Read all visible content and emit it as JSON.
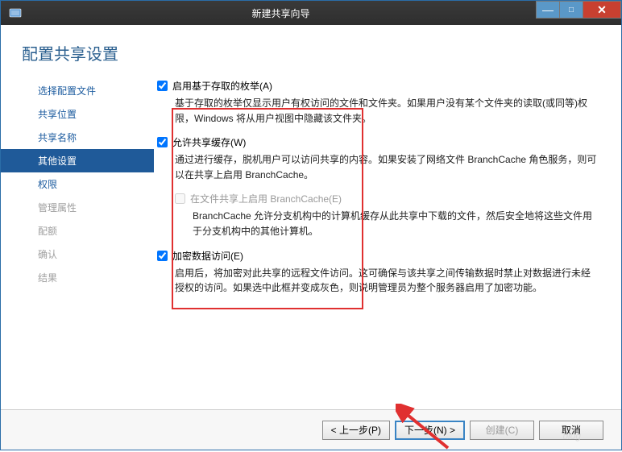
{
  "window": {
    "title": "新建共享向导"
  },
  "header": {
    "title": "配置共享设置"
  },
  "sidebar": {
    "items": [
      {
        "label": "选择配置文件",
        "state": "normal"
      },
      {
        "label": "共享位置",
        "state": "normal"
      },
      {
        "label": "共享名称",
        "state": "normal"
      },
      {
        "label": "其他设置",
        "state": "active"
      },
      {
        "label": "权限",
        "state": "normal"
      },
      {
        "label": "管理属性",
        "state": "disabled"
      },
      {
        "label": "配额",
        "state": "disabled"
      },
      {
        "label": "确认",
        "state": "disabled"
      },
      {
        "label": "结果",
        "state": "disabled"
      }
    ]
  },
  "options": {
    "abe": {
      "label": "启用基于存取的枚举(A)",
      "checked": true,
      "desc": "基于存取的枚举仅显示用户有权访问的文件和文件夹。如果用户没有某个文件夹的读取(或同等)权限，Windows 将从用户视图中隐藏该文件夹。"
    },
    "cache": {
      "label": "允许共享缓存(W)",
      "checked": true,
      "desc": "通过进行缓存，脱机用户可以访问共享的内容。如果安装了网络文件 BranchCache 角色服务，则可以在共享上启用 BranchCache。",
      "sub": {
        "label": "在文件共享上启用 BranchCache(E)",
        "checked": false,
        "enabled": false,
        "desc": "BranchCache 允许分支机构中的计算机缓存从此共享中下载的文件，然后安全地将这些文件用于分支机构中的其他计算机。"
      }
    },
    "encrypt": {
      "label": "加密数据访问(E)",
      "checked": true,
      "desc": "启用后，将加密对此共享的远程文件访问。这可确保与该共享之间传输数据时禁止对数据进行未经授权的访问。如果选中此框并变成灰色，则说明管理员为整个服务器启用了加密功能。"
    }
  },
  "footer": {
    "prev": "< 上一步(P)",
    "next": "下一步(N) >",
    "create": "创建(C)",
    "cancel": "取消"
  },
  "watermark": "blog"
}
